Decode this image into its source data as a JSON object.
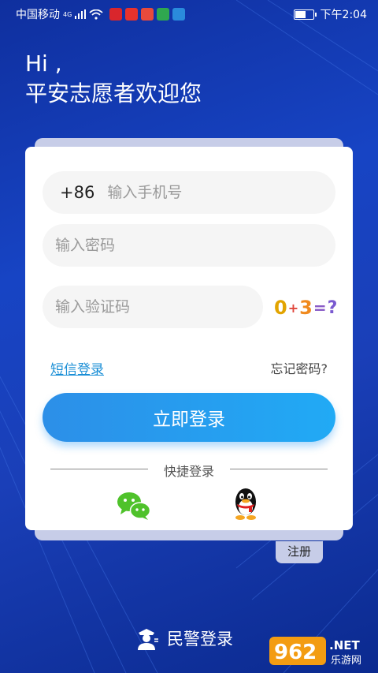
{
  "status_bar": {
    "carrier": "中国移动",
    "network": "4G",
    "time": "下午2:04",
    "battery_level": 0.55,
    "app_icons": [
      {
        "name": "netease-news-icon",
        "color": "#d9262c"
      },
      {
        "name": "weibo-icon",
        "color": "#e8322c"
      },
      {
        "name": "red-app-icon",
        "color": "#e94a3c"
      },
      {
        "name": "video-app-icon",
        "color": "#2fa84f"
      },
      {
        "name": "browser-icon",
        "color": "#2a8bdc"
      }
    ]
  },
  "greeting": {
    "hi": "Hi ,",
    "welcome": "平安志愿者欢迎您"
  },
  "form": {
    "phone_prefix": "+86",
    "phone_placeholder": "输入手机号",
    "password_placeholder": "输入密码",
    "code_placeholder": "输入验证码",
    "captcha": [
      "0",
      "+",
      "3",
      "=",
      "?"
    ],
    "sms_login": "短信登录",
    "forgot_password": "忘记密码?",
    "login_button": "立即登录",
    "quick_login": "快捷登录"
  },
  "register": "注册",
  "police_login": "民警登录",
  "watermark": {
    "number": "962",
    "suffix": ".NET",
    "label": "乐游网"
  },
  "colors": {
    "accent": "#21aaf5",
    "link": "#1b8fd6",
    "background": "#1744c4"
  }
}
